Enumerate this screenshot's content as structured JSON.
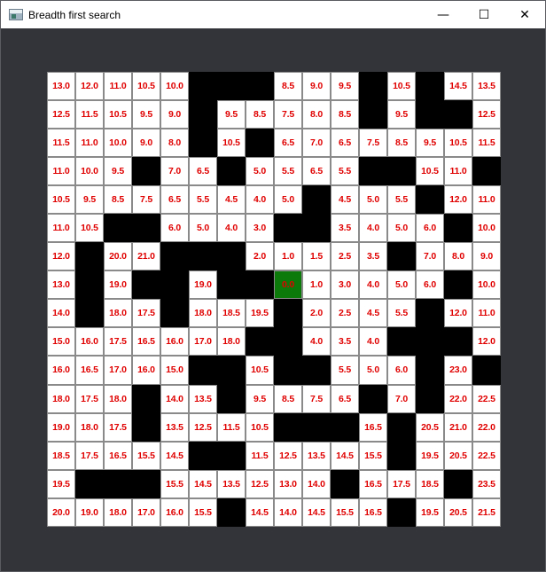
{
  "window": {
    "title": "Breadth first search",
    "controls": {
      "minimize": "—",
      "maximize": "☐",
      "close": "✕"
    }
  },
  "legend_colors": {
    "open": "#ffffff",
    "wall": "#000000",
    "goal": "#0b7a0b",
    "text": "#e00000"
  },
  "grid": {
    "rows": 16,
    "cols": 16,
    "cells": [
      [
        "13.0",
        "12.0",
        "11.0",
        "10.5",
        "10.0",
        null,
        null,
        null,
        "8.5",
        "9.0",
        "9.5",
        null,
        "10.5",
        null,
        "14.5",
        "13.5"
      ],
      [
        "12.5",
        "11.5",
        "10.5",
        "9.5",
        "9.0",
        null,
        "9.5",
        "8.5",
        "7.5",
        "8.0",
        "8.5",
        null,
        "9.5",
        null,
        null,
        "12.5"
      ],
      [
        "11.5",
        "11.0",
        "10.0",
        "9.0",
        "8.0",
        null,
        "10.5",
        null,
        "6.5",
        "7.0",
        "6.5",
        "7.5",
        "8.5",
        "9.5",
        "10.5",
        "11.5"
      ],
      [
        "11.0",
        "10.0",
        "9.5",
        null,
        "7.0",
        "6.5",
        null,
        "5.0",
        "5.5",
        "6.5",
        "5.5",
        null,
        null,
        "10.5",
        "11.0",
        null
      ],
      [
        "10.5",
        "9.5",
        "8.5",
        "7.5",
        "6.5",
        "5.5",
        "4.5",
        "4.0",
        "5.0",
        null,
        "4.5",
        "5.0",
        "5.5",
        null,
        "12.0",
        "11.0"
      ],
      [
        "11.0",
        "10.5",
        null,
        null,
        "6.0",
        "5.0",
        "4.0",
        "3.0",
        null,
        null,
        "3.5",
        "4.0",
        "5.0",
        "6.0",
        null,
        "10.0"
      ],
      [
        "12.0",
        null,
        "20.0",
        "21.0",
        null,
        null,
        null,
        "2.0",
        "1.0",
        "1.5",
        "2.5",
        "3.5",
        null,
        "7.0",
        "8.0",
        "9.0"
      ],
      [
        "13.0",
        null,
        "19.0",
        null,
        null,
        "19.0",
        null,
        null,
        "0.0",
        "1.0",
        "3.0",
        "4.0",
        "5.0",
        "6.0",
        null,
        "10.0"
      ],
      [
        "14.0",
        null,
        "18.0",
        "17.5",
        null,
        "18.0",
        "18.5",
        "19.5",
        null,
        "2.0",
        "2.5",
        "4.5",
        "5.5",
        null,
        "12.0",
        "11.0"
      ],
      [
        "15.0",
        "16.0",
        "17.5",
        "16.5",
        "16.0",
        "17.0",
        "18.0",
        null,
        null,
        "4.0",
        "3.5",
        "4.0",
        null,
        null,
        null,
        "12.0"
      ],
      [
        "16.0",
        "16.5",
        "17.0",
        "16.0",
        "15.0",
        null,
        null,
        "10.5",
        null,
        null,
        "5.5",
        "5.0",
        "6.0",
        null,
        "23.0",
        null
      ],
      [
        "18.0",
        "17.5",
        "18.0",
        null,
        "14.0",
        "13.5",
        null,
        "9.5",
        "8.5",
        "7.5",
        "6.5",
        null,
        "7.0",
        null,
        "22.0",
        "22.5"
      ],
      [
        "19.0",
        "18.0",
        "17.5",
        null,
        "13.5",
        "12.5",
        "11.5",
        "10.5",
        null,
        null,
        null,
        "16.5",
        null,
        "20.5",
        "21.0",
        "22.0"
      ],
      [
        "18.5",
        "17.5",
        "16.5",
        "15.5",
        "14.5",
        null,
        null,
        "11.5",
        "12.5",
        "13.5",
        "14.5",
        "15.5",
        null,
        "19.5",
        "20.5",
        "22.5"
      ],
      [
        "19.5",
        null,
        null,
        null,
        "15.5",
        "14.5",
        "13.5",
        "12.5",
        "13.0",
        "14.0",
        null,
        "16.5",
        "17.5",
        "18.5",
        null,
        "23.5"
      ],
      [
        "20.0",
        "19.0",
        "18.0",
        "17.0",
        "16.0",
        "15.5",
        null,
        "14.5",
        "14.0",
        "14.5",
        "15.5",
        "16.5",
        null,
        "19.5",
        "20.5",
        "21.5"
      ]
    ],
    "goal": {
      "row": 7,
      "col": 8
    }
  }
}
